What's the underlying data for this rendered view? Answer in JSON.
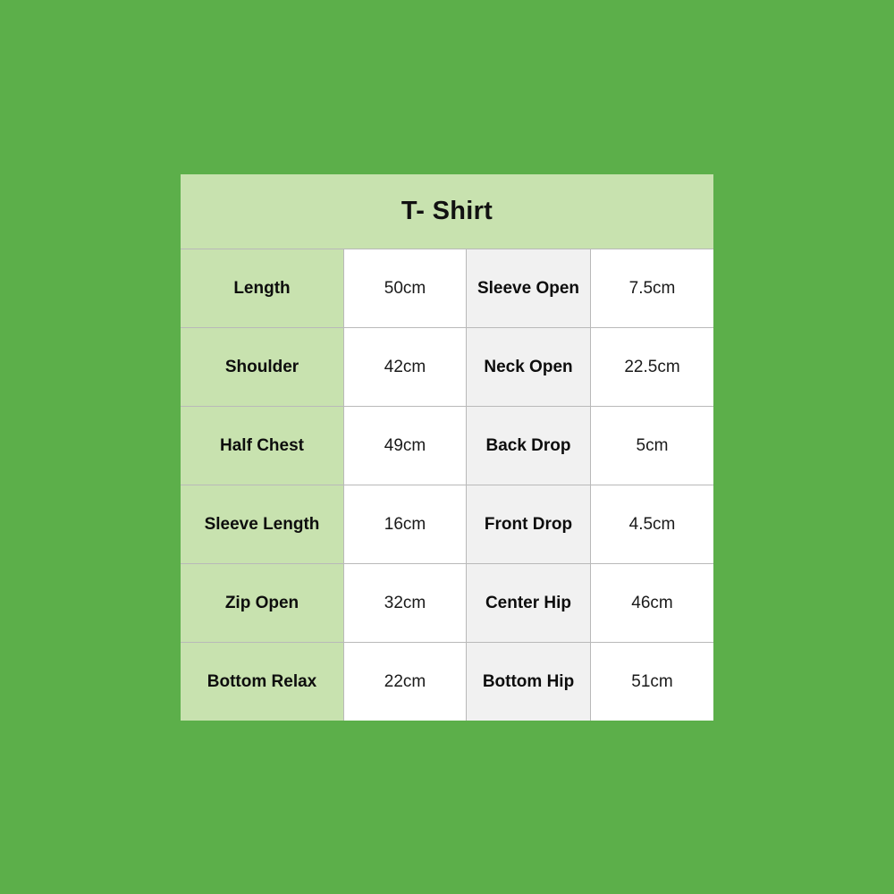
{
  "background_color": "#5CAF4A",
  "chart": {
    "title": "T- Shirt",
    "header_color": "#C8E2AF",
    "label_column_color": "#C8E2AF",
    "alt_label_column_color": "#F1F1F1",
    "value_column_color": "#FFFFFF",
    "border_color": "#B9B9B9",
    "rows": [
      {
        "label_left": "Length",
        "value_left": "50cm",
        "label_right": "Sleeve Open",
        "value_right": "7.5cm"
      },
      {
        "label_left": "Shoulder",
        "value_left": "42cm",
        "label_right": "Neck Open",
        "value_right": "22.5cm"
      },
      {
        "label_left": "Half Chest",
        "value_left": "49cm",
        "label_right": "Back Drop",
        "value_right": "5cm"
      },
      {
        "label_left": "Sleeve Length",
        "value_left": "16cm",
        "label_right": "Front Drop",
        "value_right": "4.5cm"
      },
      {
        "label_left": "Zip Open",
        "value_left": "32cm",
        "label_right": "Center Hip",
        "value_right": "46cm"
      },
      {
        "label_left": "Bottom Relax",
        "value_left": "22cm",
        "label_right": "Bottom Hip",
        "value_right": "51cm"
      }
    ]
  }
}
